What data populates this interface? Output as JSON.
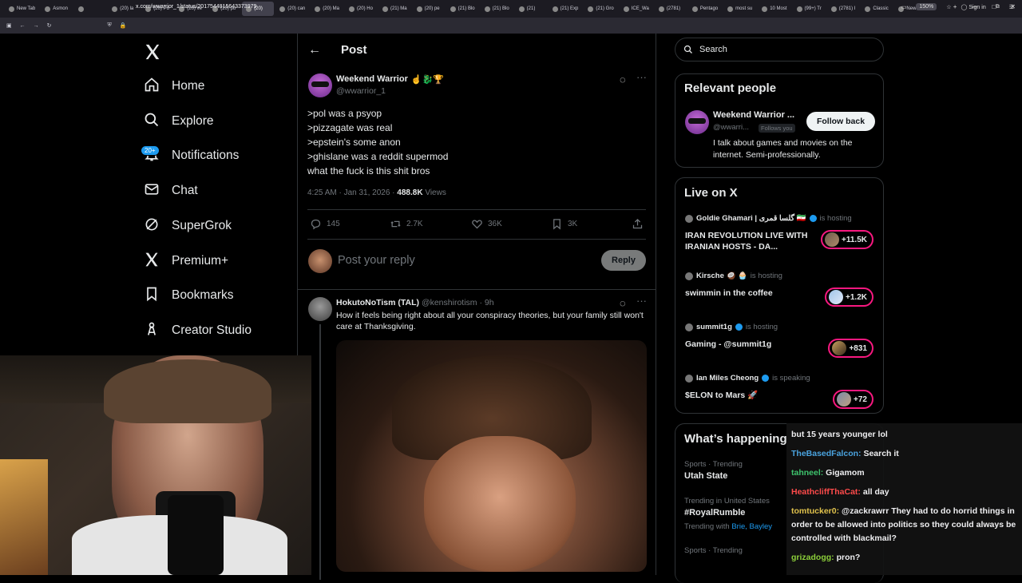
{
  "browser": {
    "tabs": [
      "New Tab",
      "Asmon",
      "",
      "(20) la",
      "(20) Po",
      "(20) ve",
      "(20) po",
      "(20)",
      "(20) can",
      "(20) Ma",
      "(20) Ho",
      "(21) Ma",
      "(20) pe",
      "(21) Blo",
      "(21) Blo",
      "(21)",
      "(21) Exp",
      "(21) Gro",
      "ICE_Wa",
      "(2781)",
      "Pentago",
      "most su",
      "10 Most",
      "(99+) Tr",
      "(2781) I",
      "Classic",
      "New Tab"
    ],
    "url": "x.com/wwarrior_1/status/2017544815643373979",
    "zoom": "150%",
    "sign_in": "Sign in"
  },
  "nav": {
    "items": [
      {
        "label": "Home",
        "icon": "home-icon"
      },
      {
        "label": "Explore",
        "icon": "search-icon"
      },
      {
        "label": "Notifications",
        "icon": "bell-icon"
      },
      {
        "label": "Chat",
        "icon": "mail-icon"
      },
      {
        "label": "SuperGrok",
        "icon": "grok-icon"
      },
      {
        "label": "Premium+",
        "icon": "x-logo-icon"
      },
      {
        "label": "Bookmarks",
        "icon": "bookmark-icon"
      },
      {
        "label": "Creator Studio",
        "icon": "creator-icon"
      }
    ],
    "notif_badge": "20+"
  },
  "post": {
    "header": "Post",
    "author_name": "Weekend Warrior",
    "author_emoji": "☝️🐉🏆",
    "author_handle": "@wwarrior_1",
    "lines": [
      ">pol was a psyop",
      ">pizzagate was real",
      ">epstein's some anon",
      ">ghislane was a reddit supermod",
      "what the fuck is this shit bros"
    ],
    "time": "4:25 AM · Jan 31, 2026 · ",
    "views_count": "488.8K",
    "views_label": " Views",
    "replies": "145",
    "reposts": "2.7K",
    "likes": "36K",
    "bookmarks": "3K",
    "reply_placeholder": "Post your reply",
    "reply_button": "Reply"
  },
  "reply": {
    "author_name": "HokutoNoTism (TAL)",
    "author_handle": "@kenshirotism",
    "time": " · 9h",
    "text": "How it feels being right about all your conspiracy theories, but your family still won't care at Thanksgiving."
  },
  "sidebar": {
    "search_placeholder": "Search",
    "relevant": {
      "title": "Relevant people",
      "name": "Weekend Warrior ...",
      "handle": "@wwarri...",
      "follows_you": "Follows you",
      "follow_button": "Follow back",
      "bio": "I talk about games and movies on the internet. Semi-professionally."
    },
    "live": {
      "title": "Live on X",
      "spaces": [
        {
          "host": "Goldie Ghamari | گلسا قمری 🇮🇷",
          "status": "is hosting",
          "title": "IRAN REVOLUTION LIVE WITH IRANIAN HOSTS - DA...",
          "count": "+11.5K"
        },
        {
          "host": "Kirsche 🥥 🧁",
          "status": "is hosting",
          "title": "swimmin in the coffee",
          "count": "+1.2K"
        },
        {
          "host": "summit1g",
          "status": "is hosting",
          "title": "Gaming - @summit1g",
          "count": "+831"
        },
        {
          "host": "Ian Miles Cheong",
          "status": "is speaking",
          "title": "$ELON to Mars 🚀",
          "count": "+72"
        }
      ]
    },
    "happening": {
      "title": "What’s happening",
      "trends": [
        {
          "context": "Sports · Trending",
          "name": "Utah State"
        },
        {
          "context": "Trending in United States",
          "name": "#RoyalRumble",
          "with_label": "Trending with ",
          "with_links": "Brie, Bayley"
        },
        {
          "context": "Sports · Trending",
          "name": ""
        }
      ]
    }
  },
  "chat": {
    "lines": [
      {
        "user": "",
        "msg": "but 15 years younger lol"
      },
      {
        "user": "TheBasedFalcon:",
        "msg": " Search it"
      },
      {
        "user": "tahneel:",
        "msg": " Gigamom"
      },
      {
        "user": "HeathcliffThaCat:",
        "msg": " all day"
      },
      {
        "user": "tomtucker0:",
        "msg": " @zackrawrr They had to do horrid things in order to be allowed into politics so they could always be controlled with blackmail?"
      },
      {
        "user": "grizadogg:",
        "msg": " pron?"
      }
    ]
  },
  "colors": {
    "accent": "#1d9bf0",
    "live_ring": "#f91880",
    "follow_button_bg": "#eff3f4"
  }
}
